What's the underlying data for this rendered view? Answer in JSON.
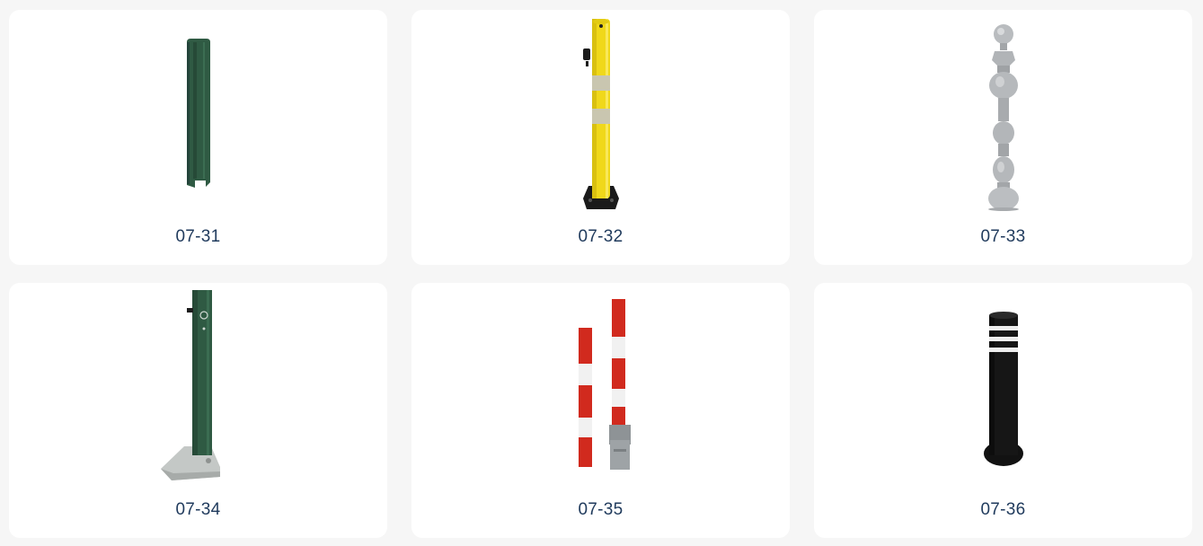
{
  "products": [
    {
      "code": "07-31",
      "icon": "green-folding-post-icon",
      "color": "#2f5a43"
    },
    {
      "code": "07-32",
      "icon": "yellow-lockable-bollard-icon",
      "color": "#f0d81a"
    },
    {
      "code": "07-33",
      "icon": "cast-iron-ornamental-bollard-icon",
      "color": "#b9bcbf"
    },
    {
      "code": "07-34",
      "icon": "green-fold-down-bollard-icon",
      "color": "#2f5a43"
    },
    {
      "code": "07-35",
      "icon": "red-white-removable-posts-icon",
      "color": "#d12a1e"
    },
    {
      "code": "07-36",
      "icon": "black-reflective-bollard-icon",
      "color": "#121212"
    }
  ]
}
